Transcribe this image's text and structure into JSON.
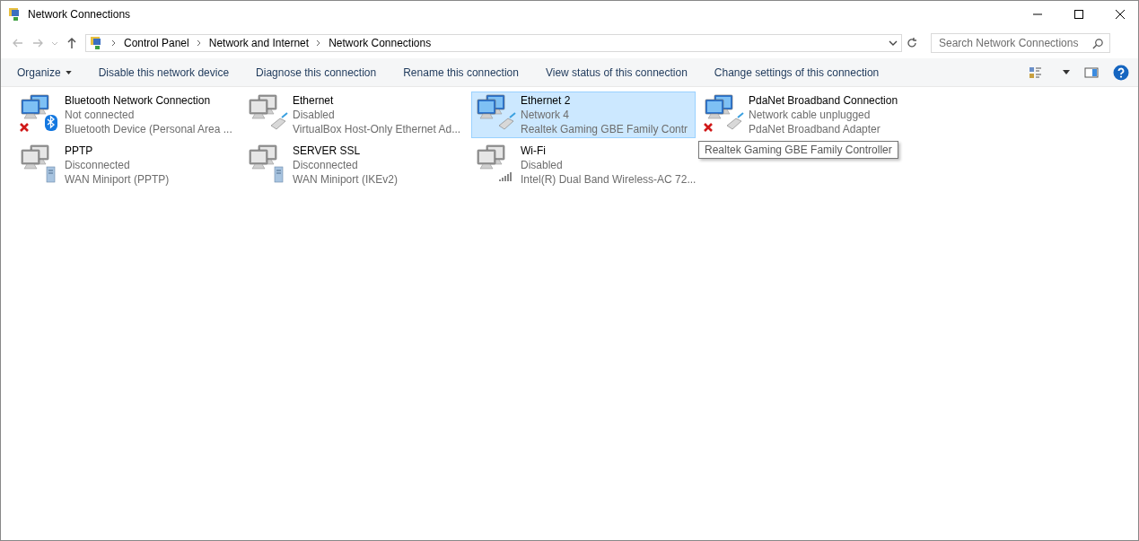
{
  "window": {
    "title": "Network Connections"
  },
  "address": {
    "crumbs": [
      "Control Panel",
      "Network and Internet",
      "Network Connections"
    ]
  },
  "search": {
    "placeholder": "Search Network Connections"
  },
  "toolbar": {
    "organize": "Organize",
    "commands": [
      "Disable this network device",
      "Diagnose this connection",
      "Rename this connection",
      "View status of this connection",
      "Change settings of this connection"
    ]
  },
  "connections": [
    {
      "name": "Bluetooth Network Connection",
      "status": "Not connected",
      "device": "Bluetooth Device (Personal Area ...",
      "kind": "bluetooth",
      "active": true,
      "error": true,
      "selected": false
    },
    {
      "name": "Ethernet",
      "status": "Disabled",
      "device": "VirtualBox Host-Only Ethernet Ad...",
      "kind": "ethernet",
      "active": false,
      "error": false,
      "selected": false
    },
    {
      "name": "Ethernet 2",
      "status": "Network 4",
      "device": "Realtek Gaming GBE Family Contr",
      "kind": "ethernet",
      "active": true,
      "error": false,
      "selected": true
    },
    {
      "name": "PdaNet Broadband Connection",
      "status": "Network cable unplugged",
      "device": "PdaNet Broadband Adapter",
      "kind": "ethernet",
      "active": true,
      "error": true,
      "selected": false
    },
    {
      "name": "PPTP",
      "status": "Disconnected",
      "device": "WAN Miniport (PPTP)",
      "kind": "wan",
      "active": false,
      "error": false,
      "selected": false
    },
    {
      "name": "SERVER SSL",
      "status": "Disconnected",
      "device": "WAN Miniport (IKEv2)",
      "kind": "wan",
      "active": false,
      "error": false,
      "selected": false
    },
    {
      "name": "Wi-Fi",
      "status": "Disabled",
      "device": "Intel(R) Dual Band Wireless-AC 72...",
      "kind": "wifi",
      "active": false,
      "error": false,
      "selected": false
    }
  ],
  "tooltip": "Realtek Gaming GBE Family Controller"
}
